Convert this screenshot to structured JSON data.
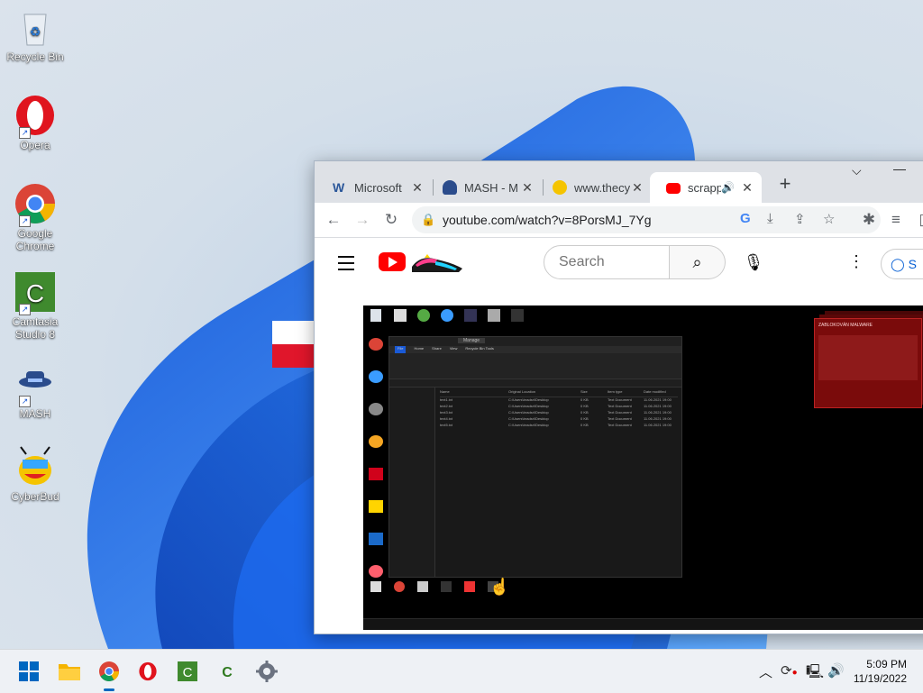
{
  "desktop": {
    "icons": [
      {
        "label": "Recycle Bin",
        "icon": "recycle-bin-icon"
      },
      {
        "label": "Opera",
        "icon": "opera-icon"
      },
      {
        "label": "Google Chrome",
        "icon": "chrome-icon"
      },
      {
        "label": "Camtasia Studio 8",
        "icon": "camtasia-icon"
      },
      {
        "label": "MASH",
        "icon": "mash-icon"
      },
      {
        "label": "CyberBud",
        "icon": "cyberbud-icon"
      }
    ]
  },
  "browser": {
    "tabs": [
      {
        "title": "Microsoft",
        "icon": "word-icon"
      },
      {
        "title": "MASH - M",
        "icon": "mash-icon"
      },
      {
        "title": "www.thecy",
        "icon": "cyberbud-icon"
      },
      {
        "title": "scrapp",
        "icon": "youtube-icon",
        "active": true
      }
    ],
    "new_tab": "+",
    "url": "youtube.com/watch?v=8PorsMJ_7Yg"
  },
  "youtube": {
    "search_placeholder": "Search",
    "sign_in": "S"
  },
  "video": {
    "window_title": "Manage",
    "explorer_tabs": [
      "File",
      "Home",
      "Share",
      "View",
      "Recycle Bin Tools"
    ],
    "explorer_columns": [
      "Name",
      "Original Location",
      "Size",
      "Item type",
      "Date modified"
    ],
    "explorer_rows": [
      [
        "text1.txt",
        "C:\\Users\\bradsrl\\Desktop",
        "0 KB",
        "Text Document",
        "11.06.2021 19:00"
      ],
      [
        "text2.txt",
        "C:\\Users\\bradsrl\\Desktop",
        "0 KB",
        "Text Document",
        "11.06.2021 19:00"
      ],
      [
        "text3.txt",
        "C:\\Users\\bradsrl\\Desktop",
        "0 KB",
        "Text Document",
        "11.06.2021 19:00"
      ],
      [
        "text4.txt",
        "C:\\Users\\bradsrl\\Desktop",
        "0 KB",
        "Text Document",
        "11.06.2021 19:00"
      ],
      [
        "text5.txt",
        "C:\\Users\\bradsrl\\Desktop",
        "0 KB",
        "Text Document",
        "11.06.2021 19:00"
      ]
    ],
    "popup_title": "ZABLOKOVÁN MALWARE"
  },
  "taskbar": {
    "apps": [
      "start-icon",
      "file-explorer-icon",
      "chrome-icon",
      "opera-icon",
      "camtasia-icon",
      "camtasia-recorder-icon",
      "settings-icon"
    ],
    "time": "5:09 PM",
    "date": "11/19/2022"
  },
  "colors": {
    "youtube_red": "#ff0000",
    "taskbar_bg": "#eef1f5",
    "chrome_tabstrip": "#dee1e6",
    "accent": "#0067c0"
  }
}
